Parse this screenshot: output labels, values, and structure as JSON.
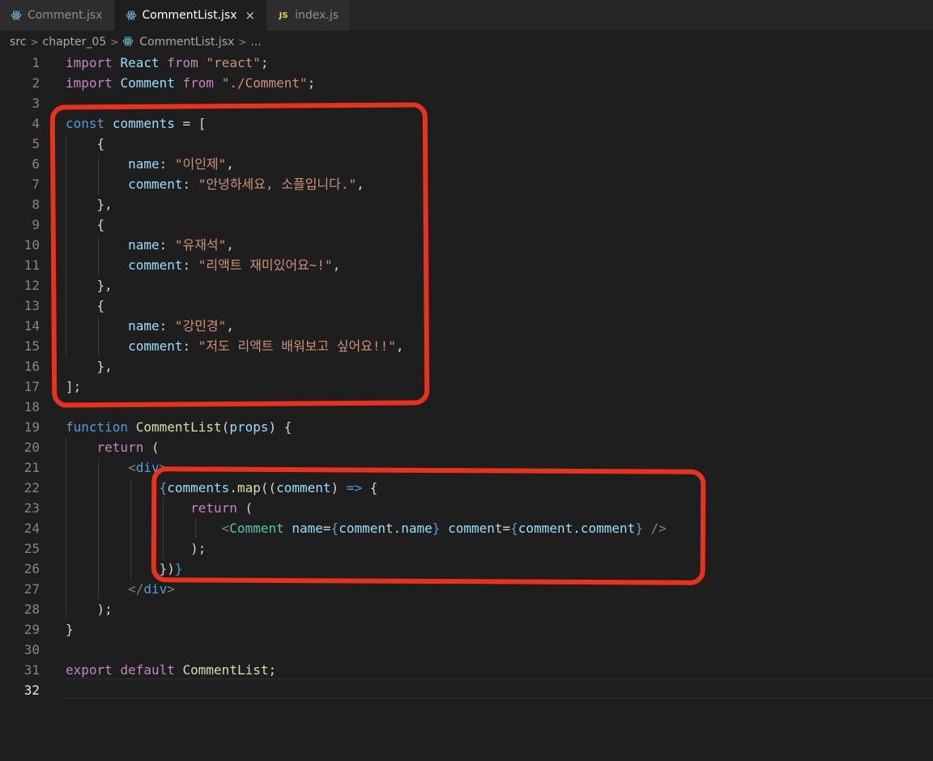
{
  "tabs": [
    {
      "label": "Comment.jsx",
      "icon": "react-icon",
      "active": false
    },
    {
      "label": "CommentList.jsx",
      "icon": "react-icon",
      "active": true,
      "close": "×"
    },
    {
      "label": "index.js",
      "icon": "js-icon",
      "icon_text": "JS",
      "active": false
    }
  ],
  "breadcrumb": {
    "items": [
      "src",
      "chapter_05",
      "CommentList.jsx",
      "..."
    ],
    "separator": ">"
  },
  "colors": {
    "annotation": "#e8321f",
    "editor_bg": "#1e1e1e",
    "keyword": "#c586c0",
    "string": "#ce9178",
    "variable": "#9cdcfe"
  },
  "editor": {
    "current_line": 32,
    "lines": [
      {
        "n": "1",
        "tokens": [
          [
            "import",
            "k"
          ],
          [
            " ",
            "p"
          ],
          [
            "React",
            "v"
          ],
          [
            " ",
            "p"
          ],
          [
            "from",
            "k"
          ],
          [
            " ",
            "p"
          ],
          [
            "\"react\"",
            "s"
          ],
          [
            ";",
            "p"
          ]
        ]
      },
      {
        "n": "2",
        "tokens": [
          [
            "import",
            "k"
          ],
          [
            " ",
            "p"
          ],
          [
            "Comment",
            "v"
          ],
          [
            " ",
            "p"
          ],
          [
            "from",
            "k"
          ],
          [
            " ",
            "p"
          ],
          [
            "\"./Comment\"",
            "s"
          ],
          [
            ";",
            "p"
          ]
        ]
      },
      {
        "n": "3",
        "tokens": []
      },
      {
        "n": "4",
        "tokens": [
          [
            "const",
            "kb"
          ],
          [
            " ",
            "p"
          ],
          [
            "comments",
            "v"
          ],
          [
            " = [",
            "p"
          ]
        ]
      },
      {
        "n": "5",
        "tokens": [
          [
            "    {",
            "p"
          ]
        ]
      },
      {
        "n": "6",
        "tokens": [
          [
            "        ",
            "p"
          ],
          [
            "name",
            "v"
          ],
          [
            ": ",
            "p"
          ],
          [
            "\"이인제\"",
            "s"
          ],
          [
            ",",
            "p"
          ]
        ]
      },
      {
        "n": "7",
        "tokens": [
          [
            "        ",
            "p"
          ],
          [
            "comment",
            "v"
          ],
          [
            ": ",
            "p"
          ],
          [
            "\"안녕하세요, 소플입니다.\"",
            "s"
          ],
          [
            ",",
            "p"
          ]
        ]
      },
      {
        "n": "8",
        "tokens": [
          [
            "    },",
            "p"
          ]
        ]
      },
      {
        "n": "9",
        "tokens": [
          [
            "    {",
            "p"
          ]
        ]
      },
      {
        "n": "10",
        "tokens": [
          [
            "        ",
            "p"
          ],
          [
            "name",
            "v"
          ],
          [
            ": ",
            "p"
          ],
          [
            "\"유재석\"",
            "s"
          ],
          [
            ",",
            "p"
          ]
        ]
      },
      {
        "n": "11",
        "tokens": [
          [
            "        ",
            "p"
          ],
          [
            "comment",
            "v"
          ],
          [
            ": ",
            "p"
          ],
          [
            "\"리액트 재미있어요~!\"",
            "s"
          ],
          [
            ",",
            "p"
          ]
        ]
      },
      {
        "n": "12",
        "tokens": [
          [
            "    },",
            "p"
          ]
        ]
      },
      {
        "n": "13",
        "tokens": [
          [
            "    {",
            "p"
          ]
        ]
      },
      {
        "n": "14",
        "tokens": [
          [
            "        ",
            "p"
          ],
          [
            "name",
            "v"
          ],
          [
            ": ",
            "p"
          ],
          [
            "\"강민경\"",
            "s"
          ],
          [
            ",",
            "p"
          ]
        ]
      },
      {
        "n": "15",
        "tokens": [
          [
            "        ",
            "p"
          ],
          [
            "comment",
            "v"
          ],
          [
            ": ",
            "p"
          ],
          [
            "\"저도 리액트 배워보고 싶어요!!\"",
            "s"
          ],
          [
            ",",
            "p"
          ]
        ]
      },
      {
        "n": "16",
        "tokens": [
          [
            "    },",
            "p"
          ]
        ]
      },
      {
        "n": "17",
        "tokens": [
          [
            "];",
            "p"
          ]
        ]
      },
      {
        "n": "18",
        "tokens": []
      },
      {
        "n": "19",
        "tokens": [
          [
            "function",
            "kb"
          ],
          [
            " ",
            "p"
          ],
          [
            "CommentList",
            "f"
          ],
          [
            "(",
            "p"
          ],
          [
            "props",
            "v"
          ],
          [
            ") {",
            "p"
          ]
        ]
      },
      {
        "n": "20",
        "tokens": [
          [
            "    ",
            "p"
          ],
          [
            "return",
            "k"
          ],
          [
            " (",
            "p"
          ]
        ]
      },
      {
        "n": "21",
        "tokens": [
          [
            "        ",
            "p"
          ],
          [
            "<",
            "g"
          ],
          [
            "div",
            "kb"
          ],
          [
            ">",
            "g"
          ]
        ]
      },
      {
        "n": "22",
        "tokens": [
          [
            "            ",
            "p"
          ],
          [
            "{",
            "br"
          ],
          [
            "comments",
            "v"
          ],
          [
            ".",
            "p"
          ],
          [
            "map",
            "f"
          ],
          [
            "((",
            "p"
          ],
          [
            "comment",
            "v"
          ],
          [
            ") ",
            "p"
          ],
          [
            "=>",
            "kb"
          ],
          [
            " {",
            "p"
          ]
        ]
      },
      {
        "n": "23",
        "tokens": [
          [
            "                ",
            "p"
          ],
          [
            "return",
            "k"
          ],
          [
            " (",
            "p"
          ]
        ]
      },
      {
        "n": "24",
        "tokens": [
          [
            "                    ",
            "p"
          ],
          [
            "<",
            "g"
          ],
          [
            "Comment",
            "t"
          ],
          [
            " ",
            "p"
          ],
          [
            "name",
            "v"
          ],
          [
            "=",
            "p"
          ],
          [
            "{",
            "br"
          ],
          [
            "comment",
            "v"
          ],
          [
            ".",
            "p"
          ],
          [
            "name",
            "v"
          ],
          [
            "}",
            "br"
          ],
          [
            " ",
            "p"
          ],
          [
            "comment",
            "v"
          ],
          [
            "=",
            "p"
          ],
          [
            "{",
            "br"
          ],
          [
            "comment",
            "v"
          ],
          [
            ".",
            "p"
          ],
          [
            "comment",
            "v"
          ],
          [
            "}",
            "br"
          ],
          [
            " />",
            "g"
          ]
        ]
      },
      {
        "n": "25",
        "tokens": [
          [
            "                ",
            "p"
          ],
          [
            ");",
            "p"
          ]
        ]
      },
      {
        "n": "26",
        "tokens": [
          [
            "            ",
            "p"
          ],
          [
            "})",
            "p"
          ],
          [
            "}",
            "br"
          ]
        ]
      },
      {
        "n": "27",
        "tokens": [
          [
            "        ",
            "p"
          ],
          [
            "</",
            "g"
          ],
          [
            "div",
            "kb"
          ],
          [
            ">",
            "g"
          ]
        ]
      },
      {
        "n": "28",
        "tokens": [
          [
            "    );",
            "p"
          ]
        ]
      },
      {
        "n": "29",
        "tokens": [
          [
            "}",
            "p"
          ]
        ]
      },
      {
        "n": "30",
        "tokens": []
      },
      {
        "n": "31",
        "tokens": [
          [
            "export",
            "k"
          ],
          [
            " ",
            "p"
          ],
          [
            "default",
            "k"
          ],
          [
            " ",
            "p"
          ],
          [
            "CommentList",
            "f"
          ],
          [
            ";",
            "p"
          ]
        ]
      },
      {
        "n": "32",
        "tokens": []
      }
    ]
  }
}
